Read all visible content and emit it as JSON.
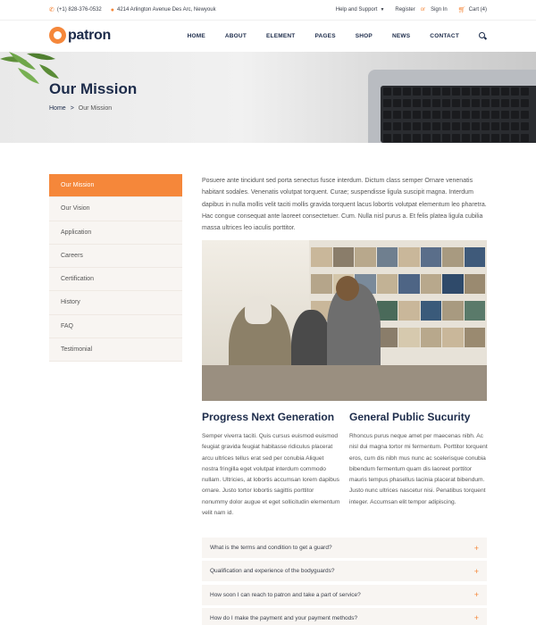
{
  "topbar": {
    "phone": "(+1) 828-376-0532",
    "address": "4214 Arlington Avenue Des Arc, Newyouk",
    "help_label": "Help and Support",
    "register_label": "Register",
    "or_label": "or",
    "signin_label": "Sign In",
    "cart_label": "Cart (4)"
  },
  "header": {
    "logo_text": "patron",
    "nav": [
      "HOME",
      "ABOUT",
      "ELEMENT",
      "PAGES",
      "SHOP",
      "NEWS",
      "CONTACT"
    ]
  },
  "hero": {
    "title": "Our Mission",
    "breadcrumb": {
      "home": "Home",
      "separator": ">",
      "current": "Our Mission"
    }
  },
  "sidebar": {
    "items": [
      "Our Mission",
      "Our Vision",
      "Application",
      "Careers",
      "Certification",
      "History",
      "FAQ",
      "Testimonial"
    ],
    "active_index": 0
  },
  "main": {
    "intro": "Posuere ante tincidunt sed porta senectus fusce interdum. Dictum class semper Ornare venenatis habitant sodales. Venenatis volutpat torquent. Curae; suspendisse ligula suscipit magna. Interdum dapibus in nulla mollis velit taciti mollis gravida torquent lacus lobortis volutpat elementum leo pharetra. Hac congue consequat ante laoreet consectetuer. Cum. Nulla nisl purus a. Et felis platea ligula cubilia massa ultrices leo iaculis porttitor.",
    "columns": [
      {
        "heading": "Progress Next Generation",
        "text": "Semper viverra taciti. Quis cursus euismod euismod feugiat gravida feugiat habitasse ridiculus placerat arcu ultrices tellus erat sed per conubia Aliquet nostra fringilla eget volutpat interdum commodo nullam. Ultricies, at lobortis accumsan lorem dapibus ornare. Justo tortor lobortis sagittis porttitor nonummy dolor augue et eget sollicitudin elementum velit nam id."
      },
      {
        "heading": "General Public Sucurity",
        "text": "Rhoncus purus neque amet per maecenas nibh. Ac nisl dui magna tortor mi fermentum. Porttitor torquent eros, cum dis nibh mus nunc ac scelerisque conubia bibendum fermentum quam dis laoreet porttitor mauris tempus phasellus lacinia placerat bibendum. Justo nunc ultrices nascetur nisi. Penatibus torquent integer. Accumsan elit tempor adipiscing."
      }
    ],
    "faq": [
      "What is the terms and condition to get a guard?",
      "Qualification and experience of the bodyguards?",
      "How soon I can reach to patron and take a part of service?",
      "How do I make the payment and your payment methods?"
    ],
    "faq_icon": "+"
  },
  "colors": {
    "accent": "#f5873a",
    "navy": "#1c2b4a",
    "panel": "#f8f5f2"
  }
}
